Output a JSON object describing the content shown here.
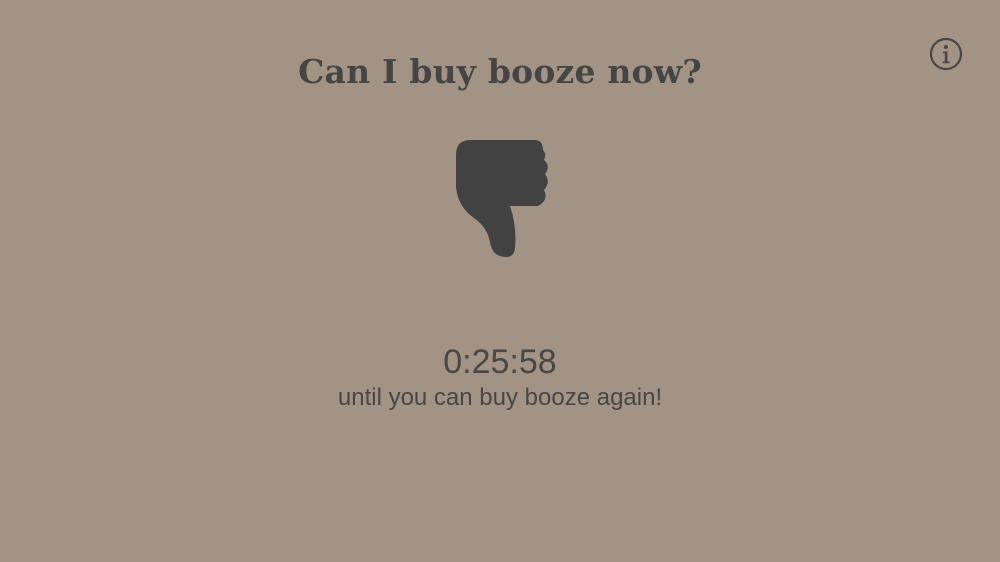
{
  "header": {
    "title": "Can I buy booze now?"
  },
  "info_button": {
    "icon": "info-icon"
  },
  "status": {
    "icon": "thumbs-down-icon",
    "countdown": "0:25:58",
    "message": "until you can buy booze again!"
  },
  "colors": {
    "background": "#a39385",
    "foreground": "#434343"
  }
}
